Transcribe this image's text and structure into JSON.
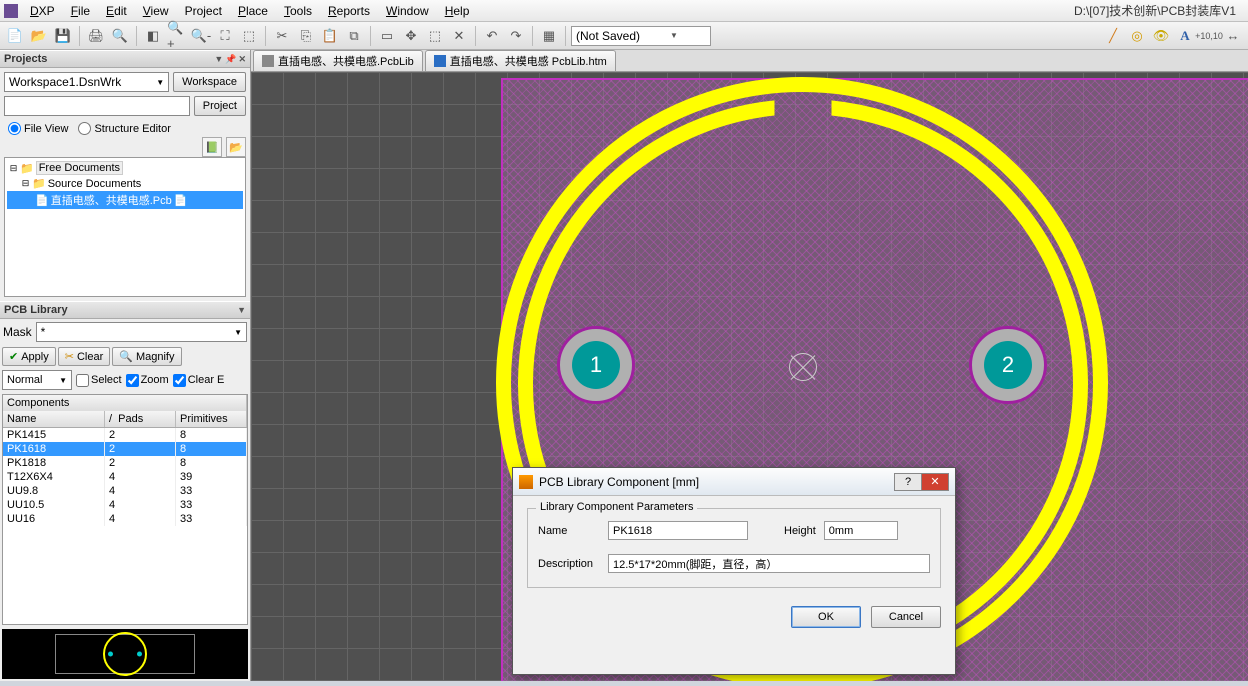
{
  "appPath": "D:\\[07]技术创新\\PCB封装库V1",
  "menu": {
    "dxp": "DXP",
    "file": "File",
    "edit": "Edit",
    "view": "View",
    "project": "Project",
    "place": "Place",
    "tools": "Tools",
    "reports": "Reports",
    "window": "Window",
    "help": "Help"
  },
  "toolbar": {
    "notSaved": "(Not Saved)"
  },
  "projectsPanel": {
    "title": "Projects",
    "workspaceCombo": "Workspace1.DsnWrk",
    "workspaceBtn": "Workspace",
    "projectBtn": "Project",
    "fileView": "File View",
    "structureEditor": "Structure Editor",
    "treeRoot": "Free Documents",
    "treeSrc": "Source Documents",
    "treeDoc": "直插电感、共模电感.Pcb"
  },
  "pcbLib": {
    "title": "PCB Library",
    "maskLabel": "Mask",
    "maskValue": "*",
    "applyBtn": "Apply",
    "clearBtn": "Clear",
    "magnifyBtn": "Magnify",
    "normal": "Normal",
    "selectChk": "Select",
    "zoomChk": "Zoom",
    "clearEChk": "Clear E",
    "compHdr": "Components",
    "colName": "Name",
    "colPads": "Pads",
    "colPrim": "Primitives",
    "rows": [
      {
        "n": "PK1415",
        "p": "2",
        "q": "8"
      },
      {
        "n": "PK1618",
        "p": "2",
        "q": "8"
      },
      {
        "n": "PK1818",
        "p": "2",
        "q": "8"
      },
      {
        "n": "T12X6X4",
        "p": "4",
        "q": "39"
      },
      {
        "n": "UU9.8",
        "p": "4",
        "q": "33"
      },
      {
        "n": "UU10.5",
        "p": "4",
        "q": "33"
      },
      {
        "n": "UU16",
        "p": "4",
        "q": "33"
      }
    ],
    "selectedIndex": 1,
    "pads": {
      "1": "1",
      "2": "2"
    }
  },
  "tabs": {
    "t1": "直插电感、共模电感.PcbLib",
    "t2": "直插电感、共模电感 PcbLib.htm"
  },
  "dialog": {
    "title": "PCB Library Component [mm]",
    "group": "Library Component Parameters",
    "nameLbl": "Name",
    "nameVal": "PK1618",
    "heightLbl": "Height",
    "heightVal": "0mm",
    "descLbl": "Description",
    "descVal": "12.5*17*20mm(脚距，直径，高）",
    "ok": "OK",
    "cancel": "Cancel",
    "help": "?",
    "close": "✕"
  }
}
